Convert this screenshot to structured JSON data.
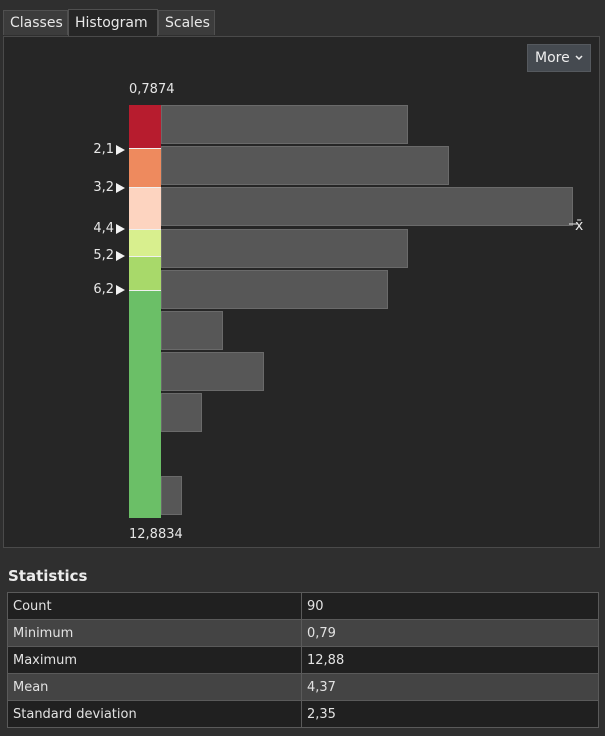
{
  "tabs": [
    {
      "label": "Classes",
      "active": false
    },
    {
      "label": "Histogram",
      "active": true
    },
    {
      "label": "Scales",
      "active": false
    }
  ],
  "more_label": "More",
  "histogram": {
    "max_label": "0,7874",
    "min_label": "12,8834",
    "mean_symbol": "x̄",
    "bin_counts": [
      12,
      14,
      20,
      12,
      11,
      3,
      5,
      2,
      0,
      1
    ],
    "breaks": [
      "2,1",
      "3,2",
      "4,4",
      "5,2",
      "6,2"
    ],
    "class_colors": [
      "#b71c2e",
      "#ee8a5e",
      "#fdd4c0",
      "#d8ef8e",
      "#a8d96a",
      "#6bbf67"
    ]
  },
  "statistics": {
    "title": "Statistics",
    "rows": [
      {
        "label": "Count",
        "value": "90"
      },
      {
        "label": "Minimum",
        "value": "0,79"
      },
      {
        "label": "Maximum",
        "value": "12,88"
      },
      {
        "label": "Mean",
        "value": "4,37"
      },
      {
        "label": "Standard deviation",
        "value": "2,35"
      }
    ]
  }
}
